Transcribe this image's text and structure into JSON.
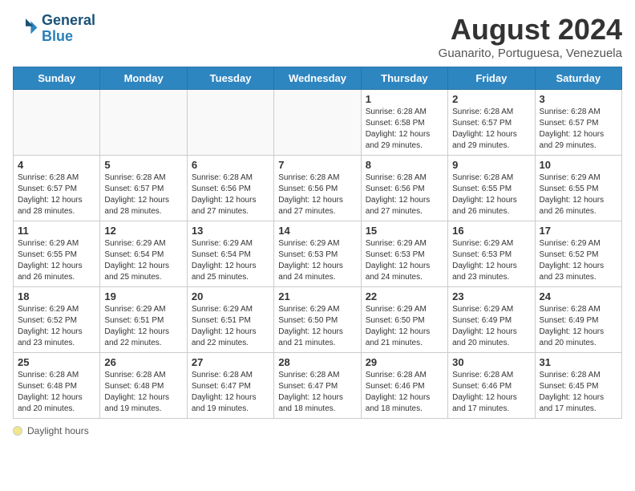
{
  "logo": {
    "line1": "General",
    "line2": "Blue"
  },
  "title": "August 2024",
  "location": "Guanarito, Portuguesa, Venezuela",
  "days_of_week": [
    "Sunday",
    "Monday",
    "Tuesday",
    "Wednesday",
    "Thursday",
    "Friday",
    "Saturday"
  ],
  "weeks": [
    [
      {
        "day": "",
        "info": ""
      },
      {
        "day": "",
        "info": ""
      },
      {
        "day": "",
        "info": ""
      },
      {
        "day": "",
        "info": ""
      },
      {
        "day": "1",
        "info": "Sunrise: 6:28 AM\nSunset: 6:58 PM\nDaylight: 12 hours\nand 29 minutes."
      },
      {
        "day": "2",
        "info": "Sunrise: 6:28 AM\nSunset: 6:57 PM\nDaylight: 12 hours\nand 29 minutes."
      },
      {
        "day": "3",
        "info": "Sunrise: 6:28 AM\nSunset: 6:57 PM\nDaylight: 12 hours\nand 29 minutes."
      }
    ],
    [
      {
        "day": "4",
        "info": "Sunrise: 6:28 AM\nSunset: 6:57 PM\nDaylight: 12 hours\nand 28 minutes."
      },
      {
        "day": "5",
        "info": "Sunrise: 6:28 AM\nSunset: 6:57 PM\nDaylight: 12 hours\nand 28 minutes."
      },
      {
        "day": "6",
        "info": "Sunrise: 6:28 AM\nSunset: 6:56 PM\nDaylight: 12 hours\nand 27 minutes."
      },
      {
        "day": "7",
        "info": "Sunrise: 6:28 AM\nSunset: 6:56 PM\nDaylight: 12 hours\nand 27 minutes."
      },
      {
        "day": "8",
        "info": "Sunrise: 6:28 AM\nSunset: 6:56 PM\nDaylight: 12 hours\nand 27 minutes."
      },
      {
        "day": "9",
        "info": "Sunrise: 6:28 AM\nSunset: 6:55 PM\nDaylight: 12 hours\nand 26 minutes."
      },
      {
        "day": "10",
        "info": "Sunrise: 6:29 AM\nSunset: 6:55 PM\nDaylight: 12 hours\nand 26 minutes."
      }
    ],
    [
      {
        "day": "11",
        "info": "Sunrise: 6:29 AM\nSunset: 6:55 PM\nDaylight: 12 hours\nand 26 minutes."
      },
      {
        "day": "12",
        "info": "Sunrise: 6:29 AM\nSunset: 6:54 PM\nDaylight: 12 hours\nand 25 minutes."
      },
      {
        "day": "13",
        "info": "Sunrise: 6:29 AM\nSunset: 6:54 PM\nDaylight: 12 hours\nand 25 minutes."
      },
      {
        "day": "14",
        "info": "Sunrise: 6:29 AM\nSunset: 6:53 PM\nDaylight: 12 hours\nand 24 minutes."
      },
      {
        "day": "15",
        "info": "Sunrise: 6:29 AM\nSunset: 6:53 PM\nDaylight: 12 hours\nand 24 minutes."
      },
      {
        "day": "16",
        "info": "Sunrise: 6:29 AM\nSunset: 6:53 PM\nDaylight: 12 hours\nand 23 minutes."
      },
      {
        "day": "17",
        "info": "Sunrise: 6:29 AM\nSunset: 6:52 PM\nDaylight: 12 hours\nand 23 minutes."
      }
    ],
    [
      {
        "day": "18",
        "info": "Sunrise: 6:29 AM\nSunset: 6:52 PM\nDaylight: 12 hours\nand 23 minutes."
      },
      {
        "day": "19",
        "info": "Sunrise: 6:29 AM\nSunset: 6:51 PM\nDaylight: 12 hours\nand 22 minutes."
      },
      {
        "day": "20",
        "info": "Sunrise: 6:29 AM\nSunset: 6:51 PM\nDaylight: 12 hours\nand 22 minutes."
      },
      {
        "day": "21",
        "info": "Sunrise: 6:29 AM\nSunset: 6:50 PM\nDaylight: 12 hours\nand 21 minutes."
      },
      {
        "day": "22",
        "info": "Sunrise: 6:29 AM\nSunset: 6:50 PM\nDaylight: 12 hours\nand 21 minutes."
      },
      {
        "day": "23",
        "info": "Sunrise: 6:29 AM\nSunset: 6:49 PM\nDaylight: 12 hours\nand 20 minutes."
      },
      {
        "day": "24",
        "info": "Sunrise: 6:28 AM\nSunset: 6:49 PM\nDaylight: 12 hours\nand 20 minutes."
      }
    ],
    [
      {
        "day": "25",
        "info": "Sunrise: 6:28 AM\nSunset: 6:48 PM\nDaylight: 12 hours\nand 20 minutes."
      },
      {
        "day": "26",
        "info": "Sunrise: 6:28 AM\nSunset: 6:48 PM\nDaylight: 12 hours\nand 19 minutes."
      },
      {
        "day": "27",
        "info": "Sunrise: 6:28 AM\nSunset: 6:47 PM\nDaylight: 12 hours\nand 19 minutes."
      },
      {
        "day": "28",
        "info": "Sunrise: 6:28 AM\nSunset: 6:47 PM\nDaylight: 12 hours\nand 18 minutes."
      },
      {
        "day": "29",
        "info": "Sunrise: 6:28 AM\nSunset: 6:46 PM\nDaylight: 12 hours\nand 18 minutes."
      },
      {
        "day": "30",
        "info": "Sunrise: 6:28 AM\nSunset: 6:46 PM\nDaylight: 12 hours\nand 17 minutes."
      },
      {
        "day": "31",
        "info": "Sunrise: 6:28 AM\nSunset: 6:45 PM\nDaylight: 12 hours\nand 17 minutes."
      }
    ]
  ],
  "legend": {
    "daylight_label": "Daylight hours"
  },
  "colors": {
    "header_bg": "#2e86c1",
    "header_text": "#ffffff"
  }
}
